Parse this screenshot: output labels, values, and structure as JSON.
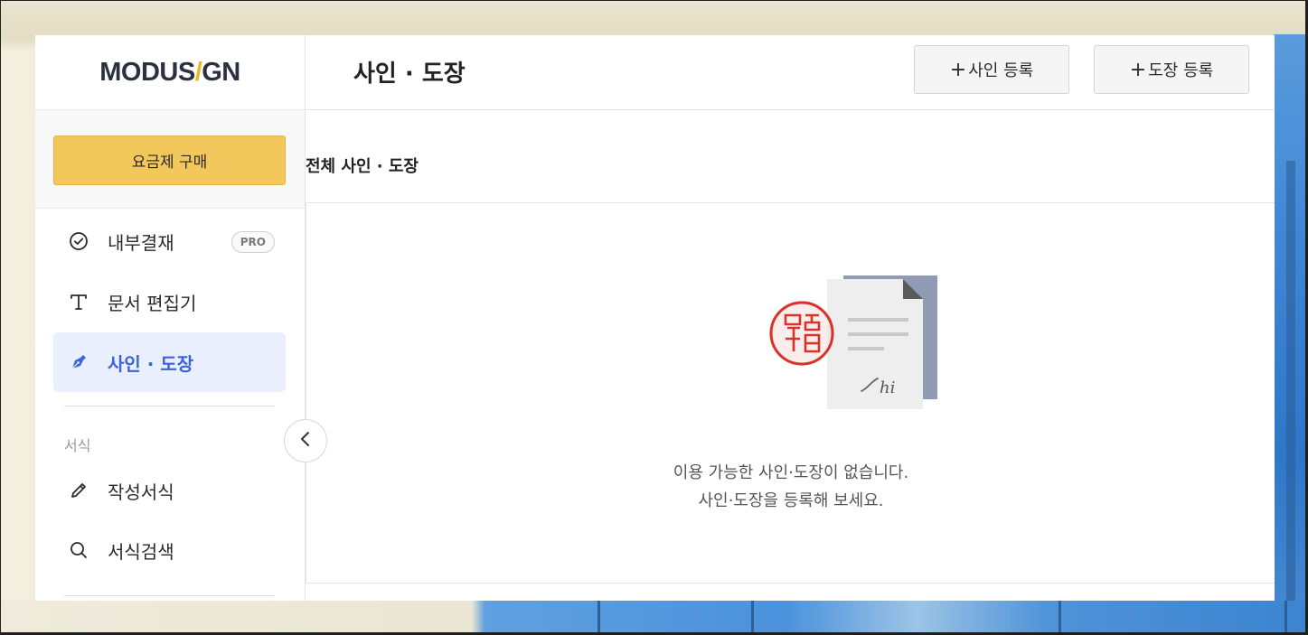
{
  "logo": {
    "part1": "MODUS",
    "slash": "/",
    "part2": "GN"
  },
  "header": {
    "title": "사인 · 도장",
    "add_sign_label": "사인 등록",
    "add_stamp_label": "도장 등록",
    "plus": "+"
  },
  "sidebar": {
    "buy_label": "요금제 구매",
    "items": [
      {
        "label": "내부결재",
        "icon": "check-circle-icon",
        "badge": "PRO"
      },
      {
        "label": "문서 편집기",
        "icon": "text-t-icon"
      },
      {
        "label": "사인 · 도장",
        "icon": "pen-nib-icon",
        "active": true
      }
    ],
    "section_label": "서식",
    "section_items": [
      {
        "label": "작성서식",
        "icon": "pencil-icon"
      },
      {
        "label": "서식검색",
        "icon": "search-icon"
      }
    ]
  },
  "content": {
    "subtitle": "전체 사인 · 도장",
    "empty_line1": "이용 가능한 사인·도장이 없습니다.",
    "empty_line2": "사인·도장을 등록해 보세요.",
    "signature_text": "hi"
  },
  "colors": {
    "accent_yellow": "#f2c75c",
    "active_blue": "#3a64d8",
    "active_bg": "#e9effd",
    "stamp_red": "#d9322b",
    "doc_back": "#8f9ab4"
  }
}
